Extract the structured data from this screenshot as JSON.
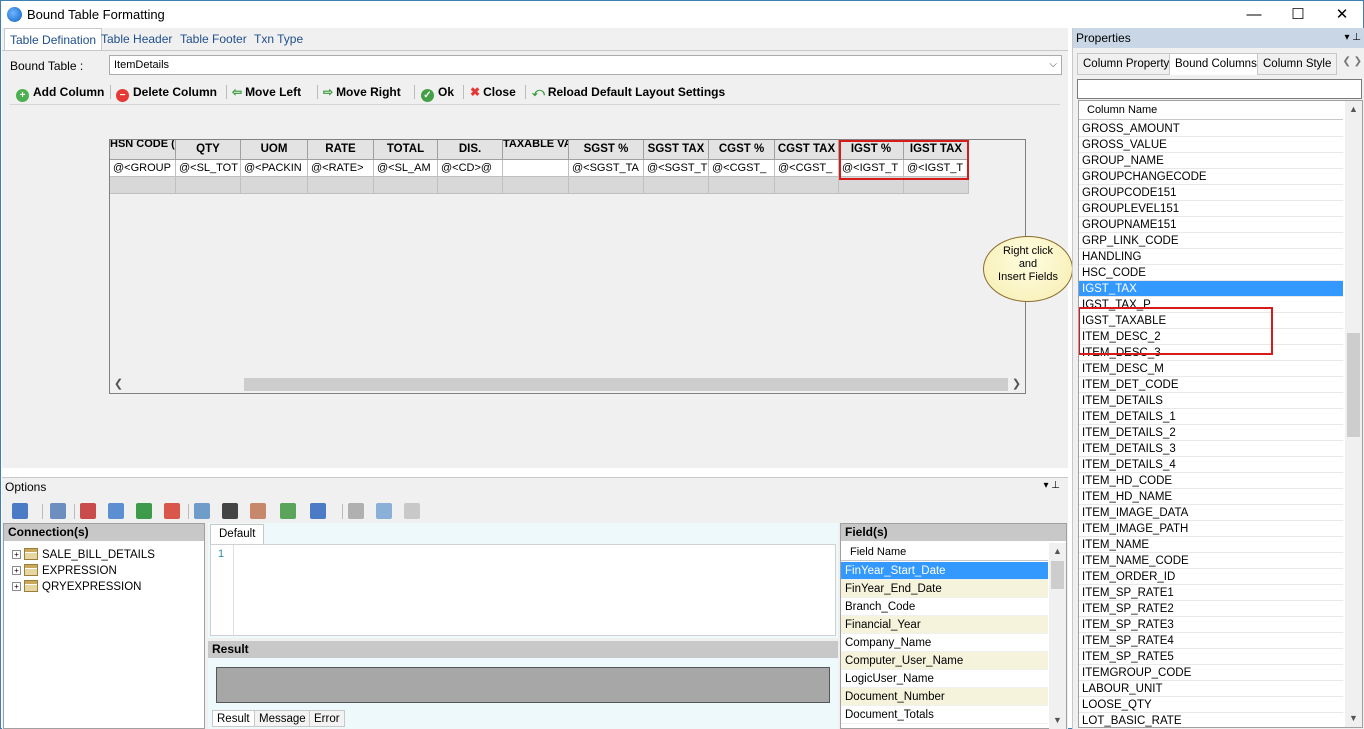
{
  "window": {
    "title": "Bound Table Formatting",
    "minimize": "—",
    "maximize": "☐",
    "close": "✕"
  },
  "tabs": [
    {
      "label": "Table Defination"
    },
    {
      "label": "Table Header"
    },
    {
      "label": "Table Footer"
    },
    {
      "label": "Txn Type"
    }
  ],
  "bound_table": {
    "label": "Bound Table :",
    "value": "ItemDetails"
  },
  "toolbar": {
    "add_column": "Add Column",
    "delete_column": "Delete Column",
    "move_left": "Move Left",
    "move_right": "Move Right",
    "ok": "Ok",
    "close": "Close",
    "reload": "Reload Default Layout Settings"
  },
  "grid": {
    "headers": [
      "HSN CODE (GS",
      "QTY",
      "UOM",
      "RATE",
      "TOTAL",
      "DIS.",
      "TAXABLE VAL",
      "SGST %",
      "SGST TAX",
      "CGST %",
      "CGST TAX",
      "IGST %",
      "IGST TAX"
    ],
    "row": [
      "@<GROUP",
      "@<SL_TOT",
      "@<PACKIN",
      "@<RATE>",
      "@<SL_AM",
      "@<CD>@",
      "",
      "@<SGST_TA",
      "@<SGST_T",
      "@<CGST_",
      "@<CGST_",
      "@<IGST_T",
      "@<IGST_T"
    ]
  },
  "callout": {
    "line1": "Right click",
    "line2": "and",
    "line3": "Insert Fields"
  },
  "options": {
    "title": "Options",
    "pins": "▾  ⊥",
    "connections": {
      "title": "Connection(s)",
      "items": [
        "SALE_BILL_DETAILS",
        "EXPRESSION",
        "QRYEXPRESSION"
      ]
    },
    "editor": {
      "tab": "Default",
      "line_number": "1"
    },
    "result": {
      "title": "Result",
      "tabs": [
        "Result",
        "Message",
        "Error"
      ]
    },
    "fields": {
      "title": "Field(s)",
      "column": "Field Name",
      "items": [
        "FinYear_Start_Date",
        "FinYear_End_Date",
        "Branch_Code",
        "Financial_Year",
        "Company_Name",
        "Computer_User_Name",
        "LogicUser_Name",
        "Document_Number",
        "Document_Totals"
      ]
    }
  },
  "properties": {
    "title": "Properties",
    "pins": "▾  ⊥",
    "tabs": [
      "Column Property",
      "Bound Columns",
      "Column Style"
    ],
    "column_header": "Column Name",
    "items": [
      "GROSS_AMOUNT",
      "GROSS_VALUE",
      "GROUP_NAME",
      "GROUPCHANGECODE",
      "GROUPCODE151",
      "GROUPLEVEL151",
      "GROUPNAME151",
      "GRP_LINK_CODE",
      "HANDLING",
      "HSC_CODE",
      "IGST_TAX",
      "IGST_TAX_P",
      "IGST_TAXABLE",
      "ITEM_DESC_2",
      "ITEM_DESC_3",
      "ITEM_DESC_M",
      "ITEM_DET_CODE",
      "ITEM_DETAILS",
      "ITEM_DETAILS_1",
      "ITEM_DETAILS_2",
      "ITEM_DETAILS_3",
      "ITEM_DETAILS_4",
      "ITEM_HD_CODE",
      "ITEM_HD_NAME",
      "ITEM_IMAGE_DATA",
      "ITEM_IMAGE_PATH",
      "ITEM_NAME",
      "ITEM_NAME_CODE",
      "ITEM_ORDER_ID",
      "ITEM_SP_RATE1",
      "ITEM_SP_RATE2",
      "ITEM_SP_RATE3",
      "ITEM_SP_RATE4",
      "ITEM_SP_RATE5",
      "ITEMGROUP_CODE",
      "LABOUR_UNIT",
      "LOOSE_QTY",
      "LOT_BASIC_RATE"
    ]
  },
  "colors": {
    "accent": "#3399ff",
    "highlight": "#d71a1a",
    "panel_header": "#c9d6e5"
  }
}
